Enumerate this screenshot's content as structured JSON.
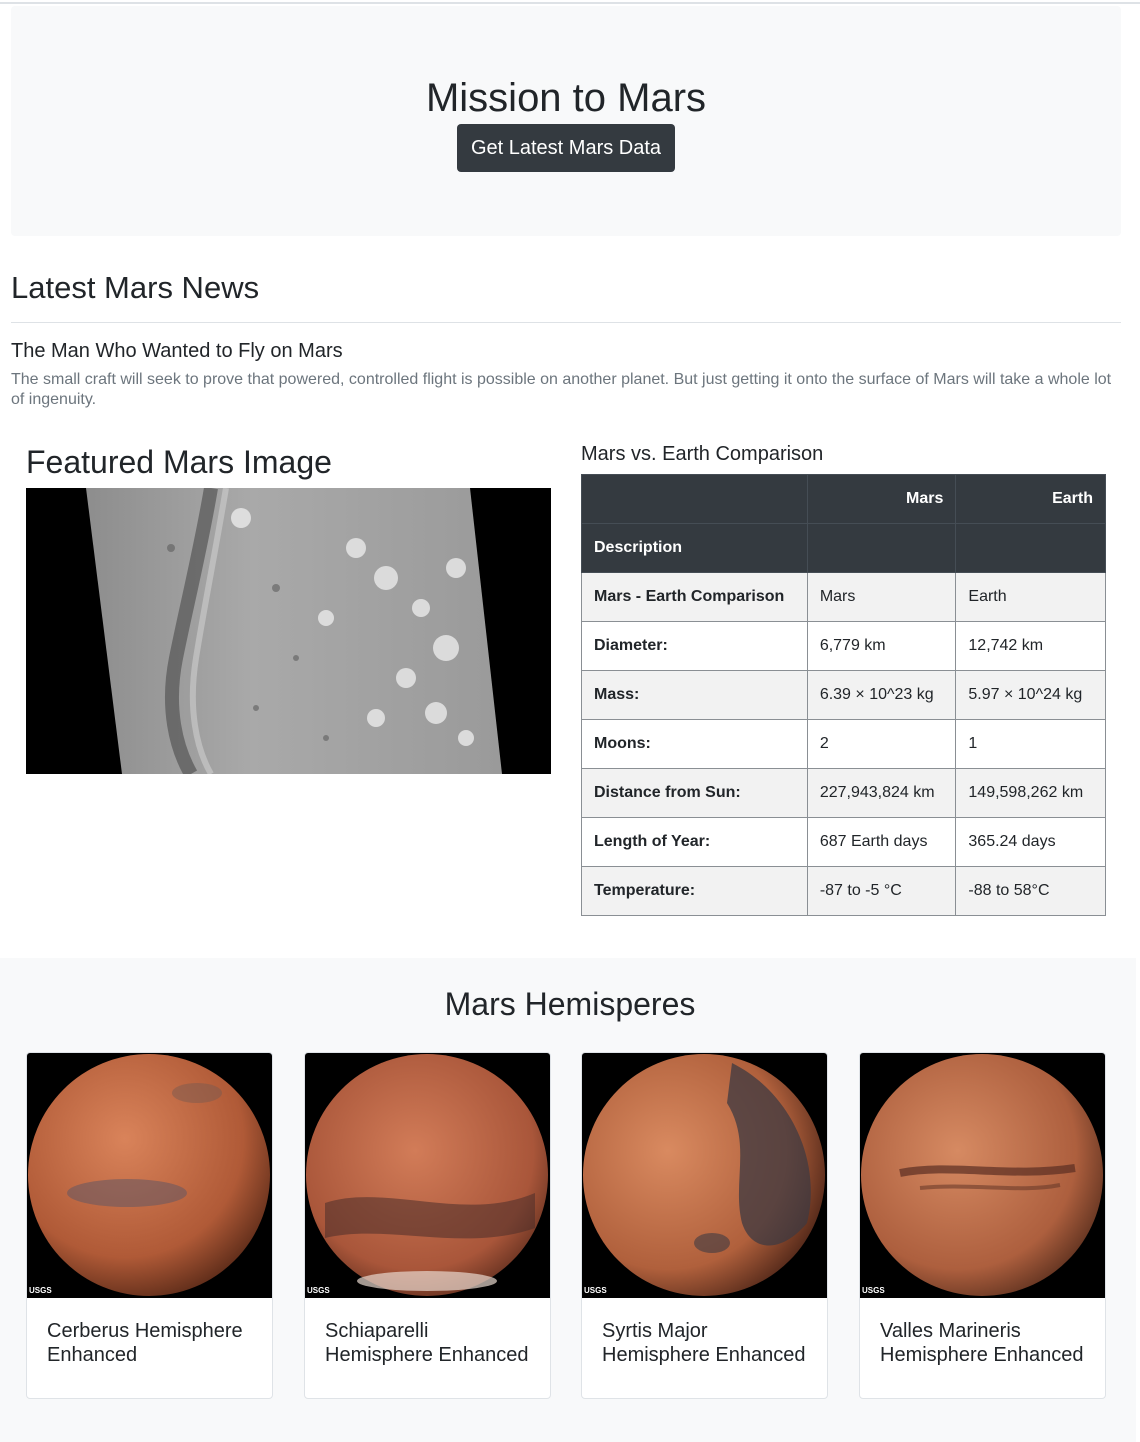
{
  "header": {
    "title": "Mission to Mars",
    "button_label": "Get Latest Mars Data"
  },
  "news": {
    "section_title": "Latest Mars News",
    "article_title": "The Man Who Wanted to Fly on Mars",
    "article_teaser": "The small craft will seek to prove that powered, controlled flight is possible on another planet. But just getting it onto the surface of Mars will take a whole lot of ingenuity."
  },
  "featured": {
    "title": "Featured Mars Image"
  },
  "comparison": {
    "title": "Mars vs. Earth Comparison",
    "head_cols": [
      "",
      "Mars",
      "Earth"
    ],
    "index_label": "Description",
    "rows": [
      {
        "label": "Mars - Earth Comparison",
        "mars": "Mars",
        "earth": "Earth"
      },
      {
        "label": "Diameter:",
        "mars": "6,779 km",
        "earth": "12,742 km"
      },
      {
        "label": "Mass:",
        "mars": "6.39 × 10^23 kg",
        "earth": "5.97 × 10^24 kg"
      },
      {
        "label": "Moons:",
        "mars": "2",
        "earth": "1"
      },
      {
        "label": "Distance from Sun:",
        "mars": "227,943,824 km",
        "earth": "149,598,262 km"
      },
      {
        "label": "Length of Year:",
        "mars": "687 Earth days",
        "earth": "365.24 days"
      },
      {
        "label": "Temperature:",
        "mars": "-87 to -5 °C",
        "earth": "-88 to 58°C"
      }
    ]
  },
  "hemispheres": {
    "title": "Mars Hemisperes",
    "watermark": "USGS",
    "items": [
      {
        "label": "Cerberus Hemisphere Enhanced"
      },
      {
        "label": "Schiaparelli Hemisphere Enhanced"
      },
      {
        "label": "Syrtis Major Hemisphere Enhanced"
      },
      {
        "label": "Valles Marineris Hemisphere Enhanced"
      }
    ]
  }
}
